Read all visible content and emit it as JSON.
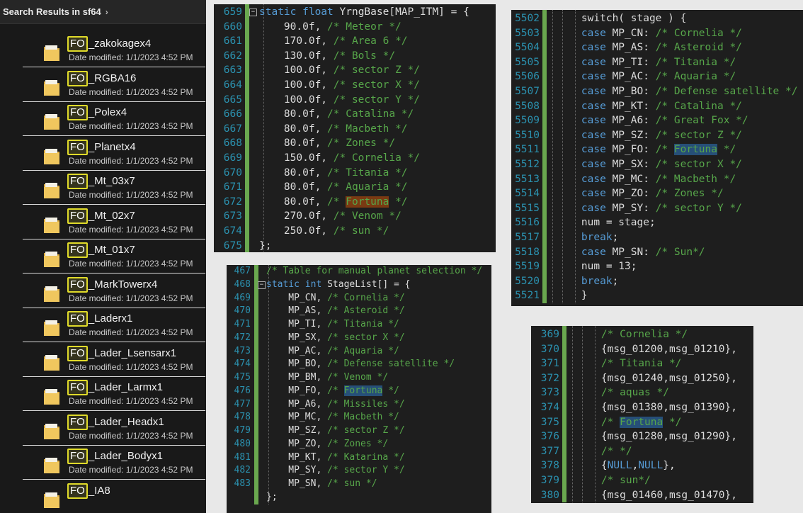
{
  "explorer": {
    "title": "Search Results in sf64",
    "rows": [
      {
        "prefix": "FO",
        "name": "_zakokagex4",
        "date": "Date modified: 1/1/2023 4:52 PM"
      },
      {
        "prefix": "FO",
        "name": "_RGBA16",
        "date": "Date modified: 1/1/2023 4:52 PM"
      },
      {
        "prefix": "FO",
        "name": "_Polex4",
        "date": "Date modified: 1/1/2023 4:52 PM"
      },
      {
        "prefix": "FO",
        "name": "_Planetx4",
        "date": "Date modified: 1/1/2023 4:52 PM"
      },
      {
        "prefix": "FO",
        "name": "_Mt_03x7",
        "date": "Date modified: 1/1/2023 4:52 PM"
      },
      {
        "prefix": "FO",
        "name": "_Mt_02x7",
        "date": "Date modified: 1/1/2023 4:52 PM"
      },
      {
        "prefix": "FO",
        "name": "_Mt_01x7",
        "date": "Date modified: 1/1/2023 4:52 PM"
      },
      {
        "prefix": "FO",
        "name": "_MarkTowerx4",
        "date": "Date modified: 1/1/2023 4:52 PM"
      },
      {
        "prefix": "FO",
        "name": "_Laderx1",
        "date": "Date modified: 1/1/2023 4:52 PM"
      },
      {
        "prefix": "FO",
        "name": "_Lader_Lsensarx1",
        "date": "Date modified: 1/1/2023 4:52 PM"
      },
      {
        "prefix": "FO",
        "name": "_Lader_Larmx1",
        "date": "Date modified: 1/1/2023 4:52 PM"
      },
      {
        "prefix": "FO",
        "name": "_Lader_Headx1",
        "date": "Date modified: 1/1/2023 4:52 PM"
      },
      {
        "prefix": "FO",
        "name": "_Lader_Bodyx1",
        "date": "Date modified: 1/1/2023 4:52 PM"
      },
      {
        "prefix": "FO",
        "name": "_IA8",
        "date": ""
      }
    ]
  },
  "panels": [
    {
      "id": "yrng",
      "lines": [
        {
          "n": "659",
          "t": [
            [
              "kw",
              "static float "
            ],
            [
              "",
              "YrngBase[MAP_ITM] = {"
            ]
          ]
        },
        {
          "n": "660",
          "t": [
            [
              "",
              "    90.0f, "
            ],
            [
              "cm",
              "/* Meteor */"
            ]
          ]
        },
        {
          "n": "661",
          "t": [
            [
              "",
              "    170.0f, "
            ],
            [
              "cm",
              "/* Area 6 */"
            ]
          ]
        },
        {
          "n": "662",
          "t": [
            [
              "",
              "    130.0f, "
            ],
            [
              "cm",
              "/* Bols */"
            ]
          ]
        },
        {
          "n": "663",
          "t": [
            [
              "",
              "    100.0f, "
            ],
            [
              "cm",
              "/* sector Z */"
            ]
          ]
        },
        {
          "n": "664",
          "t": [
            [
              "",
              "    100.0f, "
            ],
            [
              "cm",
              "/* sector X */"
            ]
          ]
        },
        {
          "n": "665",
          "t": [
            [
              "",
              "    100.0f, "
            ],
            [
              "cm",
              "/* sector Y */"
            ]
          ]
        },
        {
          "n": "666",
          "t": [
            [
              "",
              "    80.0f, "
            ],
            [
              "cm",
              "/* Catalina */"
            ]
          ]
        },
        {
          "n": "667",
          "t": [
            [
              "",
              "    80.0f, "
            ],
            [
              "cm",
              "/* Macbeth */"
            ]
          ]
        },
        {
          "n": "668",
          "t": [
            [
              "",
              "    80.0f, "
            ],
            [
              "cm",
              "/* Zones */"
            ]
          ]
        },
        {
          "n": "669",
          "t": [
            [
              "",
              "    150.0f, "
            ],
            [
              "cm",
              "/* Cornelia */"
            ]
          ]
        },
        {
          "n": "670",
          "t": [
            [
              "",
              "    80.0f, "
            ],
            [
              "cm",
              "/* Titania */"
            ]
          ]
        },
        {
          "n": "671",
          "t": [
            [
              "",
              "    80.0f, "
            ],
            [
              "cm",
              "/* Aquaria */"
            ]
          ]
        },
        {
          "n": "672",
          "t": [
            [
              "",
              "    80.0f, "
            ],
            [
              "cm",
              "/* "
            ],
            [
              "cm hlr",
              "Fortuna"
            ],
            [
              "cm",
              " */"
            ]
          ]
        },
        {
          "n": "673",
          "t": [
            [
              "",
              "    270.0f, "
            ],
            [
              "cm",
              "/* Venom */"
            ]
          ]
        },
        {
          "n": "674",
          "t": [
            [
              "",
              "    250.0f, "
            ],
            [
              "cm",
              "/* sun */"
            ]
          ]
        },
        {
          "n": "675",
          "t": [
            [
              "",
              "};"
            ]
          ]
        }
      ]
    },
    {
      "id": "stagelist",
      "lines": [
        {
          "n": "467",
          "t": [
            [
              "cm",
              "/* Table for manual planet selection */"
            ]
          ]
        },
        {
          "n": "468",
          "t": [
            [
              "kw",
              "static int "
            ],
            [
              "",
              "StageList[] = {"
            ]
          ]
        },
        {
          "n": "469",
          "t": [
            [
              "",
              "    MP_CN, "
            ],
            [
              "cm",
              "/* Cornelia */"
            ]
          ]
        },
        {
          "n": "470",
          "t": [
            [
              "",
              "    MP_AS, "
            ],
            [
              "cm",
              "/* Asteroid */"
            ]
          ]
        },
        {
          "n": "471",
          "t": [
            [
              "",
              "    MP_TI, "
            ],
            [
              "cm",
              "/* Titania */"
            ]
          ]
        },
        {
          "n": "472",
          "t": [
            [
              "",
              "    MP_SX, "
            ],
            [
              "cm",
              "/* sector X */"
            ]
          ]
        },
        {
          "n": "473",
          "t": [
            [
              "",
              "    MP_AC, "
            ],
            [
              "cm",
              "/* Aquaria */"
            ]
          ]
        },
        {
          "n": "474",
          "t": [
            [
              "",
              "    MP_BO, "
            ],
            [
              "cm",
              "/* Defense satellite */"
            ]
          ]
        },
        {
          "n": "475",
          "t": [
            [
              "",
              "    MP_BM, "
            ],
            [
              "cm",
              "/* Venom */"
            ]
          ]
        },
        {
          "n": "476",
          "t": [
            [
              "",
              "    MP_FO, "
            ],
            [
              "cm",
              "/* "
            ],
            [
              "cm hlw",
              "Fortuna"
            ],
            [
              "cm",
              " */"
            ]
          ]
        },
        {
          "n": "477",
          "t": [
            [
              "",
              "    MP_A6, "
            ],
            [
              "cm",
              "/* Missiles */"
            ]
          ]
        },
        {
          "n": "478",
          "t": [
            [
              "",
              "    MP_MC, "
            ],
            [
              "cm",
              "/* Macbeth */"
            ]
          ]
        },
        {
          "n": "479",
          "t": [
            [
              "",
              "    MP_SZ, "
            ],
            [
              "cm",
              "/* sector Z */"
            ]
          ]
        },
        {
          "n": "480",
          "t": [
            [
              "",
              "    MP_ZO, "
            ],
            [
              "cm",
              "/* Zones */"
            ]
          ]
        },
        {
          "n": "481",
          "t": [
            [
              "",
              "    MP_KT, "
            ],
            [
              "cm",
              "/* Katarina */"
            ]
          ]
        },
        {
          "n": "482",
          "t": [
            [
              "",
              "    MP_SY, "
            ],
            [
              "cm",
              "/* sector Y */"
            ]
          ]
        },
        {
          "n": "483",
          "t": [
            [
              "",
              "    MP_SN, "
            ],
            [
              "cm",
              "/* sun */"
            ]
          ]
        },
        {
          "n": "",
          "t": [
            [
              "",
              "};"
            ]
          ]
        }
      ]
    },
    {
      "id": "switch",
      "lines": [
        {
          "n": "5502",
          "t": [
            [
              "",
              "    switch( stage ) {"
            ]
          ]
        },
        {
          "n": "5503",
          "t": [
            [
              "kw",
              "    case "
            ],
            [
              "",
              "MP_CN: "
            ],
            [
              "cm",
              "/* Cornelia */"
            ]
          ]
        },
        {
          "n": "5504",
          "t": [
            [
              "kw",
              "    case "
            ],
            [
              "",
              "MP_AS: "
            ],
            [
              "cm",
              "/* Asteroid */"
            ]
          ]
        },
        {
          "n": "5505",
          "t": [
            [
              "kw",
              "    case "
            ],
            [
              "",
              "MP_TI: "
            ],
            [
              "cm",
              "/* Titania */"
            ]
          ]
        },
        {
          "n": "5506",
          "t": [
            [
              "kw",
              "    case "
            ],
            [
              "",
              "MP_AC: "
            ],
            [
              "cm",
              "/* Aquaria */"
            ]
          ]
        },
        {
          "n": "5507",
          "t": [
            [
              "kw",
              "    case "
            ],
            [
              "",
              "MP_BO: "
            ],
            [
              "cm",
              "/* Defense satellite */"
            ]
          ]
        },
        {
          "n": "5508",
          "t": [
            [
              "kw",
              "    case "
            ],
            [
              "",
              "MP_KT: "
            ],
            [
              "cm",
              "/* Catalina */"
            ]
          ]
        },
        {
          "n": "5509",
          "t": [
            [
              "kw",
              "    case "
            ],
            [
              "",
              "MP_A6: "
            ],
            [
              "cm",
              "/* Great Fox */"
            ]
          ]
        },
        {
          "n": "5510",
          "t": [
            [
              "kw",
              "    case "
            ],
            [
              "",
              "MP_SZ: "
            ],
            [
              "cm",
              "/* sector Z */"
            ]
          ]
        },
        {
          "n": "5511",
          "t": [
            [
              "kw",
              "    case "
            ],
            [
              "",
              "MP_FO: "
            ],
            [
              "cm",
              "/* "
            ],
            [
              "cm hlw",
              "Fortuna"
            ],
            [
              "cm",
              " */"
            ]
          ]
        },
        {
          "n": "5512",
          "t": [
            [
              "kw",
              "    case "
            ],
            [
              "",
              "MP_SX: "
            ],
            [
              "cm",
              "/* sector X */"
            ]
          ]
        },
        {
          "n": "5513",
          "t": [
            [
              "kw",
              "    case "
            ],
            [
              "",
              "MP_MC: "
            ],
            [
              "cm",
              "/* Macbeth */"
            ]
          ]
        },
        {
          "n": "5514",
          "t": [
            [
              "kw",
              "    case "
            ],
            [
              "",
              "MP_ZO: "
            ],
            [
              "cm",
              "/* Zones */"
            ]
          ]
        },
        {
          "n": "5515",
          "t": [
            [
              "kw",
              "    case "
            ],
            [
              "",
              "MP_SY: "
            ],
            [
              "cm",
              "/* sector Y */"
            ]
          ]
        },
        {
          "n": "5516",
          "t": [
            [
              "",
              "    num = stage;"
            ]
          ]
        },
        {
          "n": "5517",
          "t": [
            [
              "kw",
              "    break"
            ],
            [
              "",
              ";"
            ]
          ]
        },
        {
          "n": "5518",
          "t": [
            [
              "kw",
              "    case "
            ],
            [
              "",
              "MP_SN: "
            ],
            [
              "cm",
              "/* Sun*/"
            ]
          ]
        },
        {
          "n": "5519",
          "t": [
            [
              "",
              "    num = 13;"
            ]
          ]
        },
        {
          "n": "5520",
          "t": [
            [
              "kw",
              "    break"
            ],
            [
              "",
              ";"
            ]
          ]
        },
        {
          "n": "5521",
          "t": [
            [
              "",
              "    }"
            ]
          ]
        }
      ]
    },
    {
      "id": "msg",
      "lines": [
        {
          "n": "369",
          "t": [
            [
              "cm",
              "    /* Cornelia */"
            ]
          ]
        },
        {
          "n": "370",
          "t": [
            [
              "",
              "    {msg_01200,msg_01210},"
            ]
          ]
        },
        {
          "n": "371",
          "t": [
            [
              "cm",
              "    /* Titania */"
            ]
          ]
        },
        {
          "n": "372",
          "t": [
            [
              "",
              "    {msg_01240,msg_01250},"
            ]
          ]
        },
        {
          "n": "373",
          "t": [
            [
              "cm",
              "    /* aquas */"
            ]
          ]
        },
        {
          "n": "374",
          "t": [
            [
              "",
              "    {msg_01380,msg_01390},"
            ]
          ]
        },
        {
          "n": "375",
          "t": [
            [
              "cm",
              "    /* "
            ],
            [
              "cm hlw",
              "Fortuna"
            ],
            [
              "cm",
              " */"
            ]
          ]
        },
        {
          "n": "376",
          "t": [
            [
              "",
              "    {msg_01280,msg_01290},"
            ]
          ]
        },
        {
          "n": "377",
          "t": [
            [
              "cm",
              "    /* */"
            ]
          ]
        },
        {
          "n": "378",
          "t": [
            [
              "",
              "    {"
            ],
            [
              "kw",
              "NULL"
            ],
            [
              "",
              ","
            ],
            [
              "kw",
              "NULL"
            ],
            [
              "",
              "},"
            ]
          ]
        },
        {
          "n": "379",
          "t": [
            [
              "cm",
              "    /* sun*/"
            ]
          ]
        },
        {
          "n": "380",
          "t": [
            [
              "",
              "    {msg_01460,msg_01470},"
            ]
          ]
        }
      ]
    }
  ]
}
